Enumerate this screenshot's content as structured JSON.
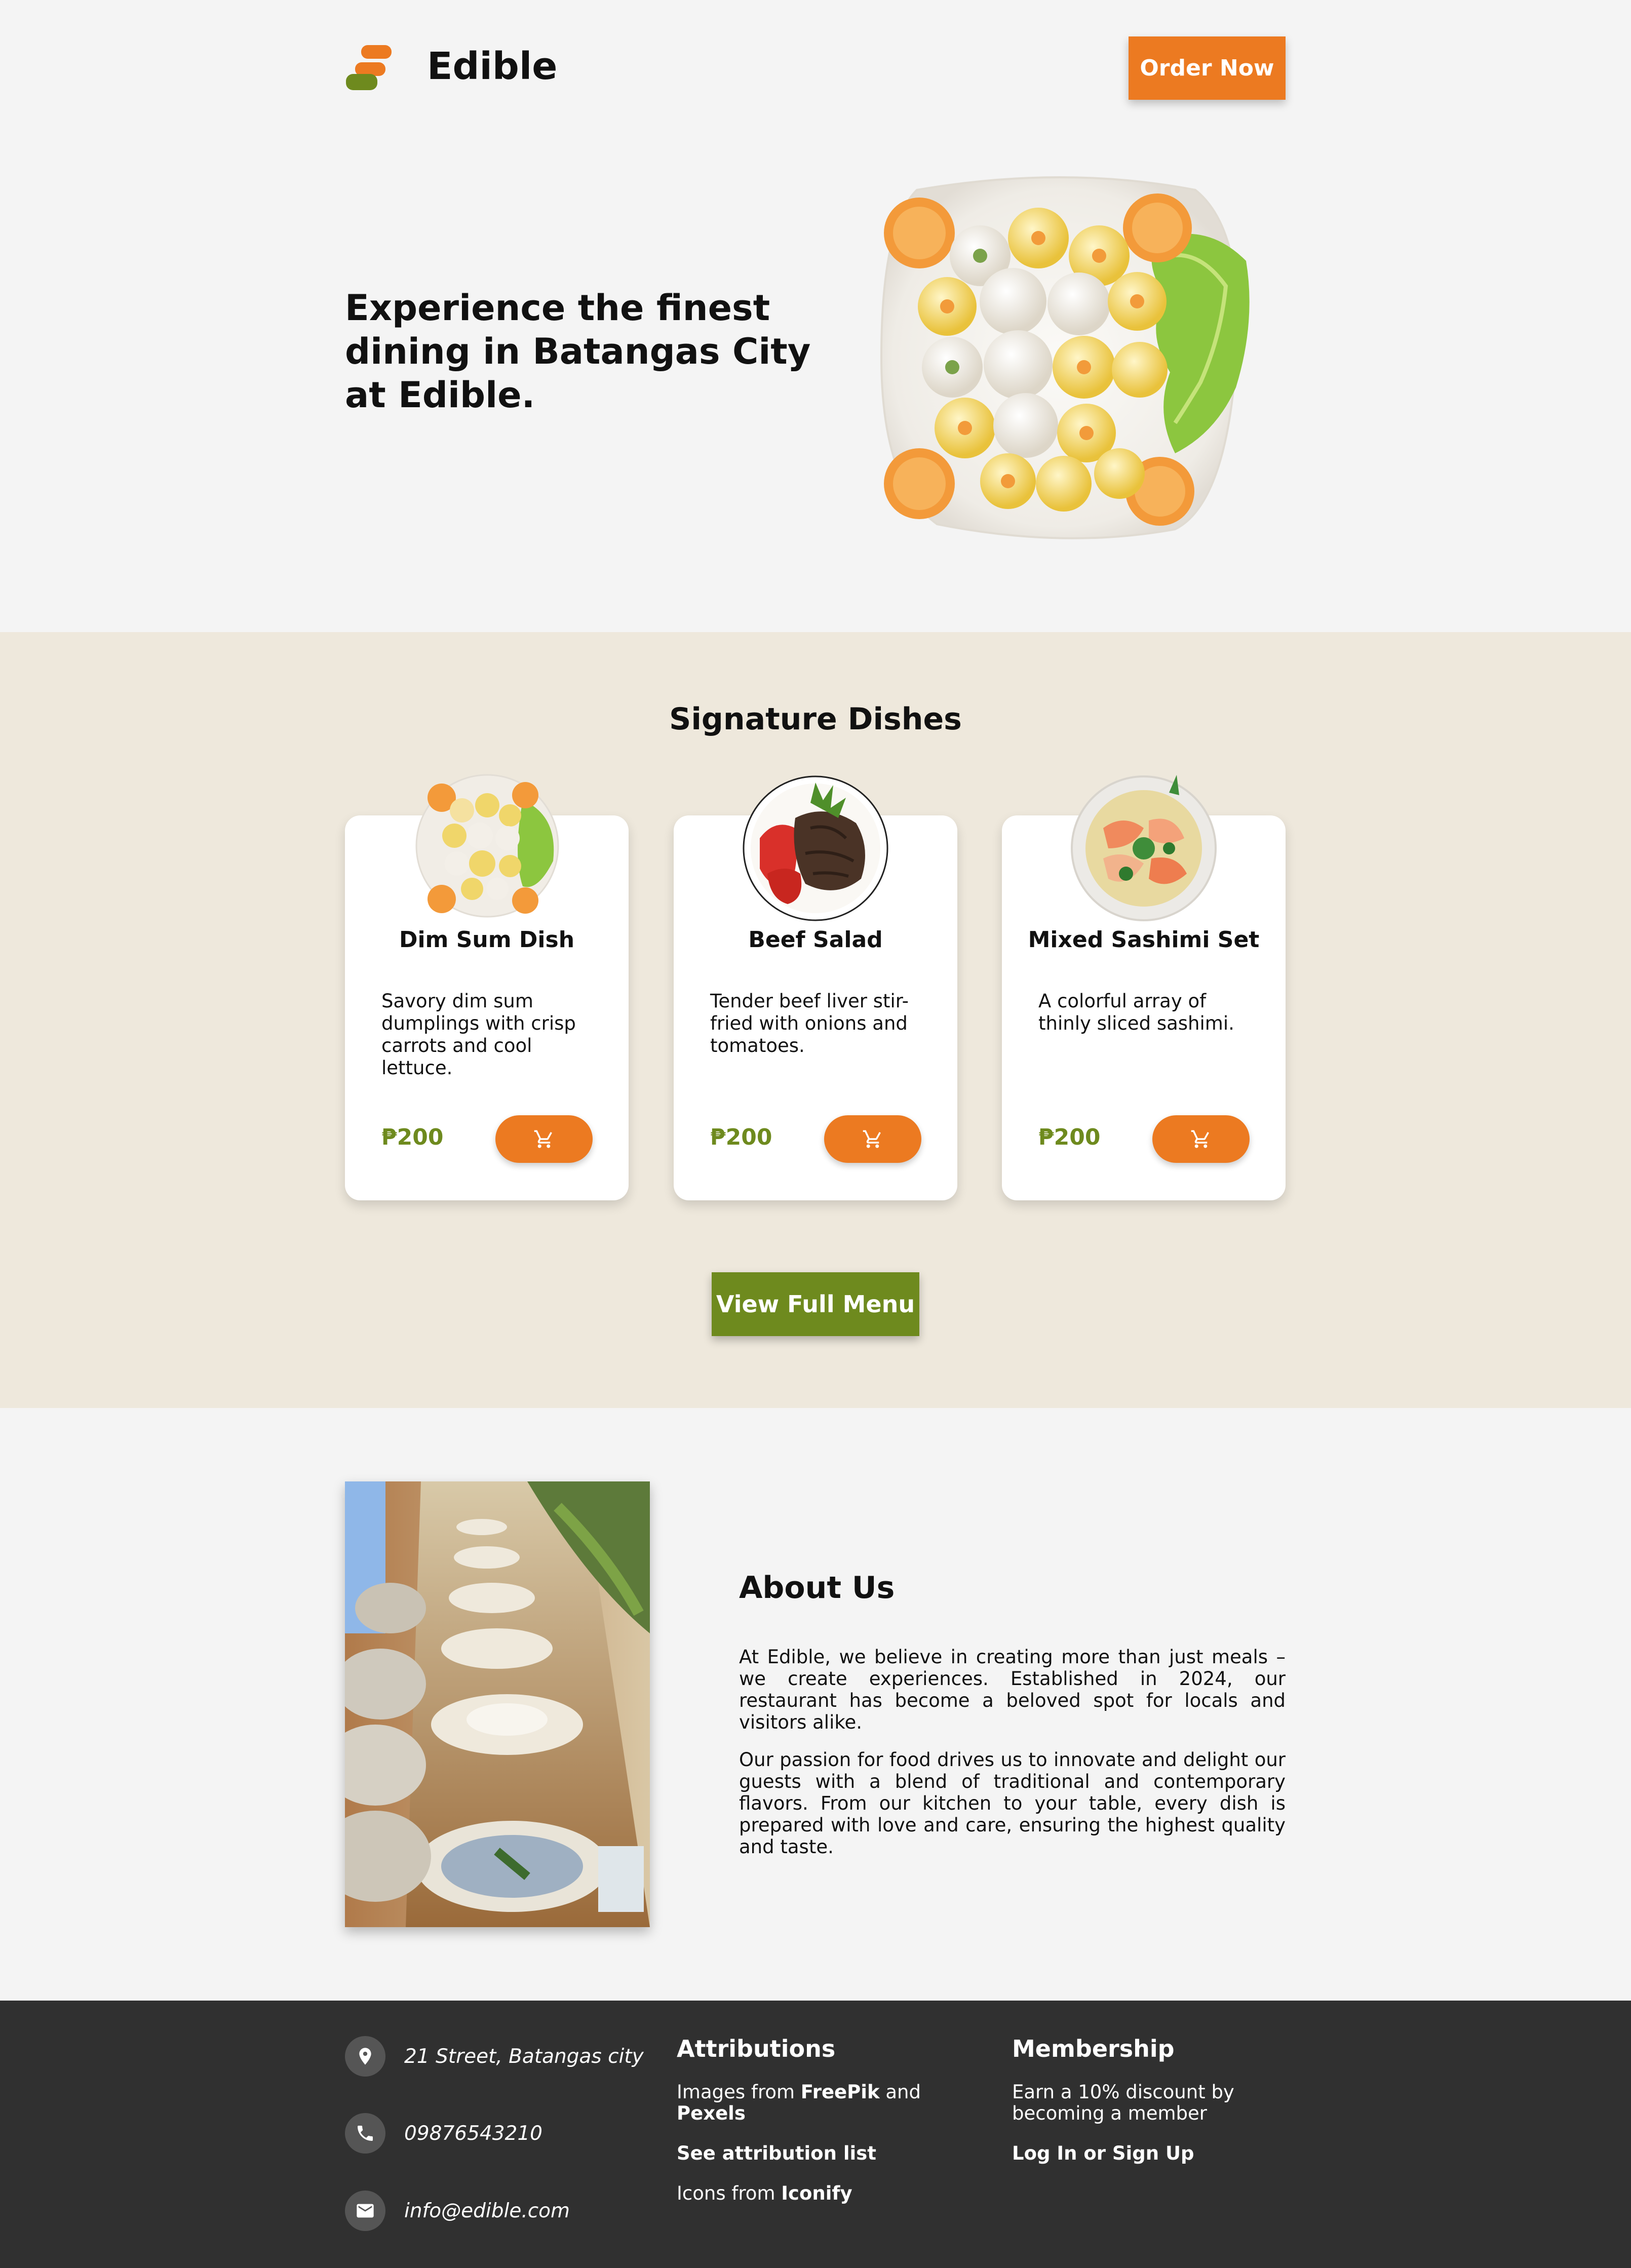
{
  "header": {
    "brand": "Edible",
    "order_button": "Order Now"
  },
  "hero": {
    "title_line1": "Experience the finest",
    "title_line2": "dining in Batangas City",
    "title_line3": "at Edible."
  },
  "signature": {
    "title": "Signature Dishes",
    "dishes": [
      {
        "name": "Dim Sum Dish",
        "desc_lines": [
          "Savory dim sum",
          "dumplings with crisp",
          "carrots and cool",
          "lettuce."
        ],
        "price": "₱200",
        "cart_icon": "cart-icon"
      },
      {
        "name": "Beef Salad",
        "desc_lines": [
          "Tender beef liver stir-",
          "fried with onions and",
          "tomatoes."
        ],
        "price": "₱200",
        "cart_icon": "cart-icon"
      },
      {
        "name": "Mixed Sashimi Set",
        "desc_lines": [
          "A colorful array of",
          "thinly sliced sashimi."
        ],
        "price": "₱200",
        "cart_icon": "cart-icon"
      }
    ],
    "menu_button": "View Full Menu"
  },
  "about": {
    "title": "About Us",
    "para1_lines": [
      "At Edible, we believe in creating more than just meals – we",
      "create experiences. Established in 2024, our restaurant has",
      "become a beloved spot for locals and visitors alike."
    ],
    "para2_lines": [
      "Our passion for food drives us to innovate and delight our",
      "guests with a blend of traditional and contemporary flavors.",
      "From our kitchen to your table, every dish is prepared with",
      "love and care, ensuring the highest quality and taste."
    ]
  },
  "footer": {
    "address": "21 Street, Batangas city",
    "phone": "09876543210",
    "email": "info@edible.com",
    "attributions_title": "Attributions",
    "images_from": "Images from",
    "freepik": "FreePik",
    "and": "and",
    "pexels": "Pexels",
    "see_list": "See attribution list",
    "icons_from": "Icons from",
    "iconify": "Iconify",
    "membership_title": "Membership",
    "membership_line1": "Earn a 10% discount by",
    "membership_line2": "becoming a member",
    "login": "Log In or Sign Up"
  },
  "colors": {
    "accent_orange": "#ec7a21",
    "accent_green": "#6e8a1e",
    "section_beige": "#eee8dc",
    "footer_dark": "#303030"
  }
}
